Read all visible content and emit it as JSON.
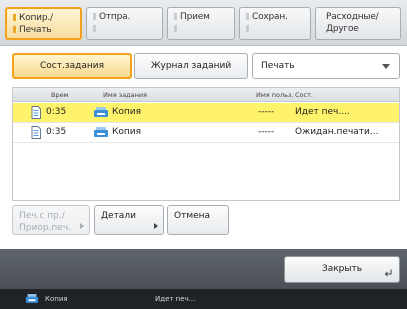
{
  "tabs": [
    {
      "label_line1": "Копир./",
      "label_line2": "Печать",
      "active": true
    },
    {
      "label_line1": "Отпра.",
      "label_line2": "",
      "active": false
    },
    {
      "label_line1": "Прием",
      "label_line2": "",
      "active": false
    },
    {
      "label_line1": "Сохран.",
      "label_line2": "",
      "active": false
    },
    {
      "label_line1": "Расходные/",
      "label_line2": "Другое",
      "active": false
    }
  ],
  "toolbar": {
    "status_tab": "Сост.задания",
    "log_tab": "Журнал заданий",
    "filter_value": "Печать"
  },
  "list": {
    "headers": {
      "time": "Врем",
      "job_name": "Имя задания",
      "user_name": "Имя польз.",
      "status": "Сост."
    },
    "rows": [
      {
        "time": "0:35",
        "job_name": "Копия",
        "user_name": "-----",
        "status": "Идет печ....",
        "selected": true
      },
      {
        "time": "0:35",
        "job_name": "Копия",
        "user_name": "-----",
        "status": "Ожидан.печати...",
        "selected": false
      }
    ]
  },
  "actions": {
    "print_next_line1": "Печ.с пр./",
    "print_next_line2": "Приор.печ.",
    "details": "Детали",
    "cancel": "Отмена"
  },
  "footer": {
    "close_label": "Закрыть"
  },
  "statusbar": {
    "job": "Копия",
    "state": "Идет печ..."
  },
  "colors": {
    "accent": "#f5a11c",
    "selected_row": "#fff36b",
    "footer": "#54595f"
  }
}
